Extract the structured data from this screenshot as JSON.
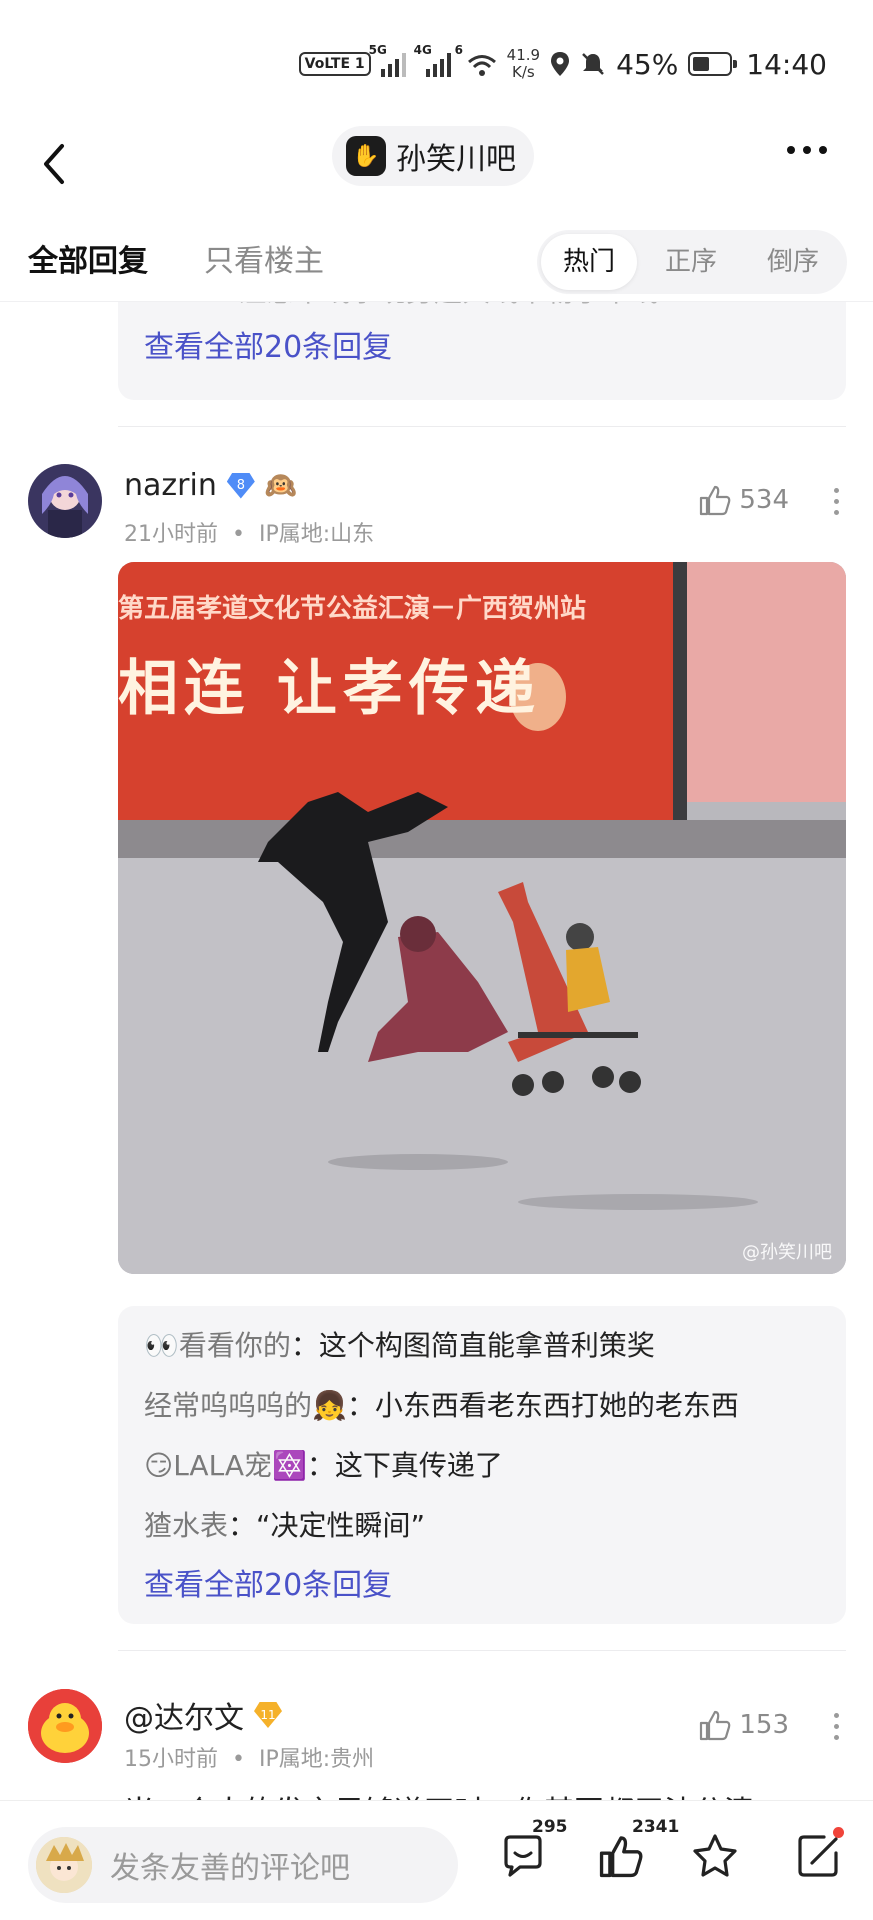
{
  "status_bar": {
    "volte": "VoLTE",
    "sim_num": "1",
    "sig1_label": "5G",
    "sig2_label": "4G",
    "sig3_label": "6",
    "speed_value": "41.9",
    "speed_unit": "K/s",
    "battery": "45%",
    "battery_level": 0.45,
    "time": "14:40"
  },
  "header": {
    "forum_name": "孙笑川吧"
  },
  "filter": {
    "tab_all": "全部回复",
    "tab_op": "只看楼主",
    "sort_hot": "热门",
    "sort_asc": "正序",
    "sort_desc": "倒序"
  },
  "prev_post": {
    "partial_line": "wind：注意末线李现身超大线本物子中线",
    "view_all": "查看全部20条回复"
  },
  "post1": {
    "username": "nazrin",
    "level": "8",
    "emoji_badge": "🙉",
    "time": "21小时前",
    "ip": "IP属地:山东",
    "likes": "534",
    "image": {
      "banner_line1": "第五届孝道文化节公益汇演－广西贺州站",
      "banner_line2": "相连  让孝传递",
      "watermark": "@孙笑川吧"
    },
    "replies": [
      {
        "who": "👀看看你的",
        "text": "：这个构图简直能拿普利策奖"
      },
      {
        "who": "经常呜呜呜的👧",
        "text": "：小东西看老东西打她的老东西"
      },
      {
        "who": "😏LALA宠🔯",
        "text": "：这下真传递了"
      },
      {
        "who": "猹水表",
        "text": "：“决定性瞬间”"
      }
    ],
    "view_all": "查看全部20条回复"
  },
  "post2": {
    "username": "@达尔文",
    "level": "11",
    "time": "15小时前",
    "ip": "IP属地:贵州",
    "likes": "153",
    "text_partial": "当一个人的发言足够道正时，你甚至都无法分清"
  },
  "bottom_bar": {
    "placeholder": "发条友善的评论吧",
    "comment_count": "295",
    "like_count": "2341"
  },
  "colors": {
    "accent_link": "#4a52c8",
    "reply_bg": "#f5f5f7",
    "notify_red": "#f0443a"
  }
}
